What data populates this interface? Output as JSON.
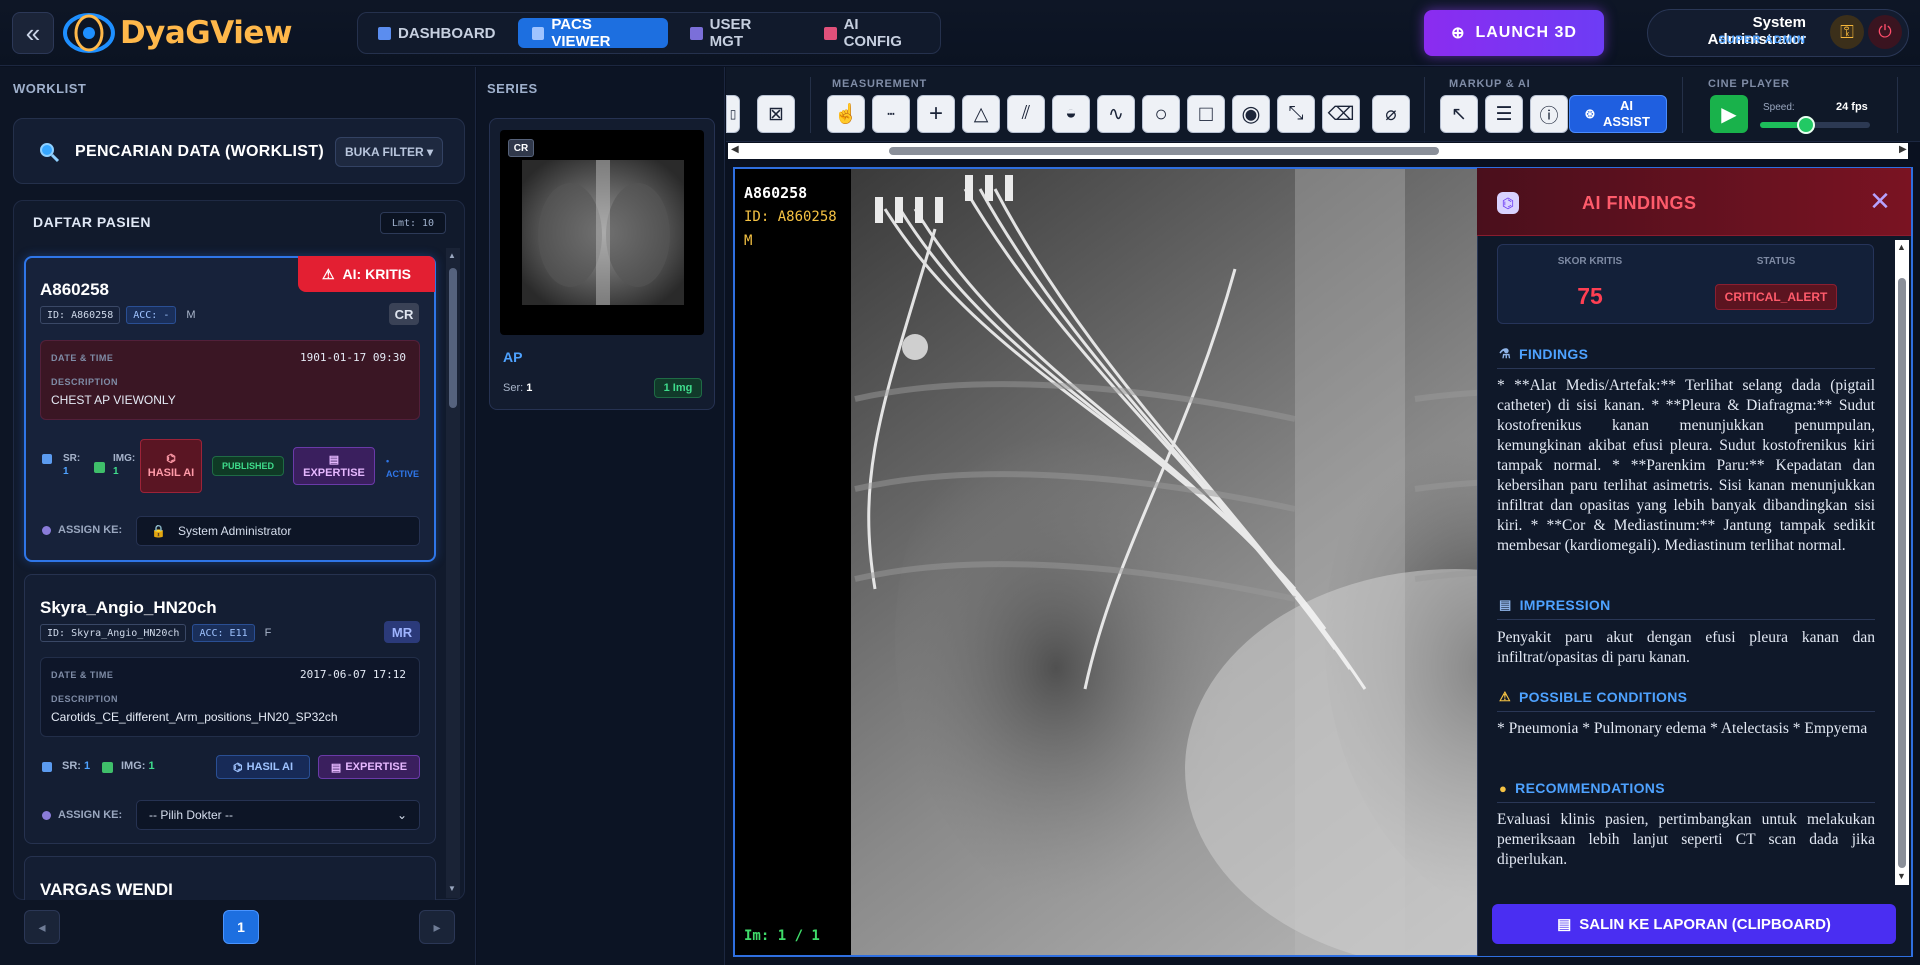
{
  "app": {
    "brand": "DyaGView",
    "collapse_icon": "«"
  },
  "nav": {
    "tabs": [
      {
        "label": "DASHBOARD",
        "active": false,
        "icon": "bar-chart-icon"
      },
      {
        "label": "PACS VIEWER",
        "active": true,
        "icon": "monitor-icon"
      },
      {
        "label": "USER MGT",
        "active": false,
        "icon": "users-icon"
      },
      {
        "label": "AI CONFIG",
        "active": false,
        "icon": "robot-icon"
      }
    ]
  },
  "launch3d": {
    "label": "LAUNCH 3D"
  },
  "user": {
    "name": "System Administrator",
    "role": "SUPER ADMIN"
  },
  "worklist": {
    "header": "WORKLIST",
    "search_label": "PENCARIAN DATA (WORKLIST)",
    "filter_button": "BUKA FILTER ▾",
    "list_header": "DAFTAR PASIEN",
    "limit": "Lmt: 10",
    "patients": [
      {
        "name": "A860258",
        "id": "ID: A860258",
        "acc": "ACC: -",
        "sex": "M",
        "modality": "CR",
        "ai_badge": "AI: KRITIS",
        "date_label": "DATE & TIME",
        "date": "1901-01-17 09:30",
        "desc_label": "DESCRIPTION",
        "desc": "CHEST AP VIEWONLY",
        "sr_label": "SR:",
        "sr": "1",
        "img_label": "IMG:",
        "img": "1",
        "hasil_ai": "HASIL AI",
        "published": "PUBLISHED",
        "expertise": "EXPERTISE",
        "active": "• ACTIVE",
        "assign_label": "ASSIGN KE:",
        "assign_value": "System Administrator"
      },
      {
        "name": "Skyra_Angio_HN20ch",
        "id": "ID: Skyra_Angio_HN20ch",
        "acc": "ACC: E11",
        "sex": "F",
        "modality": "MR",
        "date_label": "DATE & TIME",
        "date": "2017-06-07 17:12",
        "desc_label": "DESCRIPTION",
        "desc": "Carotids_CE_different_Arm_positions_HN20_SP32ch",
        "sr_label": "SR:",
        "sr": "1",
        "img_label": "IMG:",
        "img": "1",
        "hasil_ai": "HASIL AI",
        "expertise": "EXPERTISE",
        "assign_label": "ASSIGN KE:",
        "assign_value": "-- Pilih Dokter --"
      },
      {
        "name": "VARGAS WENDI"
      }
    ],
    "pagination": {
      "prev": "◂",
      "current": "1",
      "next": "▸"
    }
  },
  "series": {
    "header": "SERIES",
    "items": [
      {
        "modality": "CR",
        "desc": "AP",
        "ser_label": "Ser:",
        "ser": "1",
        "img_count": "1 Img"
      }
    ]
  },
  "toolbar": {
    "measurement_label": "MEASUREMENT",
    "markup_label": "MARKUP & AI",
    "cine_label": "CINE PLAYER",
    "ai_assist": "AI ASSIST",
    "speed_label": "Speed:",
    "fps": "24 fps",
    "speed_level_fraction": 0.42
  },
  "viewer": {
    "patient": "A860258",
    "patient_id": "ID: A860258",
    "sex": "M",
    "image_index": "Im: 1 / 1"
  },
  "ai_findings": {
    "title": "AI FINDINGS",
    "score_label": "SKOR KRITIS",
    "score": "75",
    "status_label": "STATUS",
    "status": "CRITICAL_ALERT",
    "sections": [
      {
        "title": "FINDINGS",
        "icon": "microscope-icon",
        "text": "* **Alat Medis/Artefak:** Terlihat selang dada (pigtail catheter) di sisi kanan. * **Pleura & Diafragma:** Sudut kostofrenikus kanan menunjukkan penumpulan, kemungkinan akibat efusi pleura. Sudut kostofrenikus kiri tampak normal. * **Parenkim Paru:** Kepadatan dan kebersihan paru terlihat asimetris. Sisi kanan menunjukkan infiltrat dan opasitas yang lebih banyak dibandingkan sisi kiri. * **Cor & Mediastinum:** Jantung tampak sedikit membesar (kardiomegali). Mediastinum terlihat normal."
      },
      {
        "title": "IMPRESSION",
        "icon": "clipboard-icon",
        "text": "Penyakit paru akut dengan efusi pleura kanan dan infiltrat/opasitas di paru kanan."
      },
      {
        "title": "POSSIBLE CONDITIONS",
        "icon": "warning-icon",
        "text": "* Pneumonia * Pulmonary edema * Atelectasis * Empyema"
      },
      {
        "title": "RECOMMENDATIONS",
        "icon": "lightbulb-icon",
        "text": "Evaluasi klinis pasien, pertimbangkan untuk melakukan pemeriksaan lebih lanjut seperti CT scan dada jika diperlukan."
      }
    ],
    "copy_button": "SALIN KE LAPORAN (CLIPBOARD)"
  },
  "colors": {
    "accent": "#1d6fe0",
    "critical": "#ff3f52",
    "purple": "#6d3cf5",
    "success": "#1dbd5a"
  }
}
